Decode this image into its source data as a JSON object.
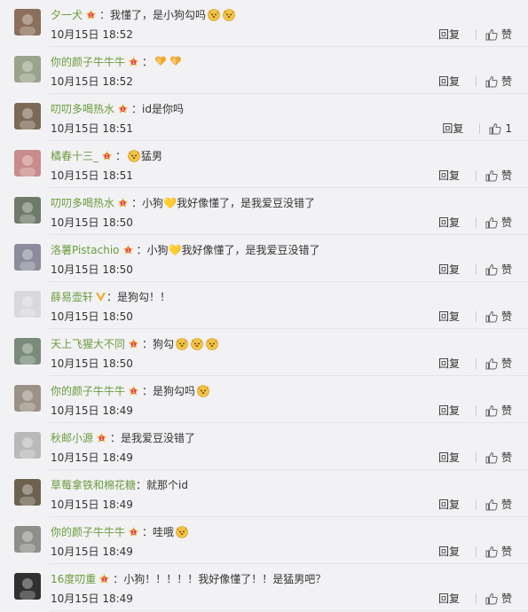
{
  "comments": [
    {
      "user": "夕一犬",
      "text": "我懂了，是小狗勾吗",
      "time": "10月15日 18:52",
      "reply": "回复",
      "like": "赞",
      "emojis": 2,
      "emo": "dog"
    },
    {
      "user": "你的颜子牛牛牛",
      "text": "",
      "time": "10月15日 18:52",
      "reply": "回复",
      "like": "赞",
      "emojis": 2,
      "emo": "heart"
    },
    {
      "user": "叨叨多喝热水",
      "text": "id是你吗",
      "time": "10月15日 18:51",
      "reply": "回复",
      "like": "1",
      "emojis": 0,
      "emo": "dog"
    },
    {
      "user": "橘春十三_",
      "text": "猛男",
      "time": "10月15日 18:51",
      "reply": "回复",
      "like": "赞",
      "emojis": 1,
      "emo": "dog",
      "emoFirst": true
    },
    {
      "user": "叨叨多喝热水",
      "text": "小狗💛我好像懂了，是我爱豆没错了",
      "time": "10月15日 18:50",
      "reply": "回复",
      "like": "赞",
      "emojis": 0,
      "emo": "dog"
    },
    {
      "user": "洛薯Pistachio",
      "text": "小狗💛我好像懂了，是我爱豆没错了",
      "time": "10月15日 18:50",
      "reply": "回复",
      "like": "赞",
      "emojis": 0,
      "emo": "dog"
    },
    {
      "user": "薛易壶轩",
      "text": "是狗勾！！",
      "time": "10月15日 18:50",
      "reply": "回复",
      "like": "赞",
      "emojis": 0,
      "emo": "dog",
      "vip": true
    },
    {
      "user": "天上飞猩大不同",
      "text": "狗勾",
      "time": "10月15日 18:50",
      "reply": "回复",
      "like": "赞",
      "emojis": 3,
      "emo": "dog"
    },
    {
      "user": "你的颜子牛牛牛",
      "text": "是狗勾吗",
      "time": "10月15日 18:49",
      "reply": "回复",
      "like": "赞",
      "emojis": 1,
      "emo": "dog"
    },
    {
      "user": "秋邮小源",
      "text": "是我爱豆没错了",
      "time": "10月15日 18:49",
      "reply": "回复",
      "like": "赞",
      "emojis": 0,
      "emo": "dog"
    },
    {
      "user": "草莓拿铁和棉花糖",
      "text": "就那个id",
      "time": "10月15日 18:49",
      "reply": "回复",
      "like": "赞",
      "emojis": 0,
      "emo": "dog",
      "nobadge": true
    },
    {
      "user": "你的颜子牛牛牛",
      "text": "哇哦",
      "time": "10月15日 18:49",
      "reply": "回复",
      "like": "赞",
      "emojis": 1,
      "emo": "dog"
    },
    {
      "user": "16度叨重",
      "text": "小狗！！！！！我好像懂了！！是猛男吧？",
      "time": "10月15日 18:49",
      "reply": "回复",
      "like": "赞",
      "emojis": 0,
      "emo": "dog"
    }
  ],
  "colors": {
    "username": "#6a9c3c",
    "background": "#f2f2f5",
    "divider": "#e3e3e8"
  }
}
